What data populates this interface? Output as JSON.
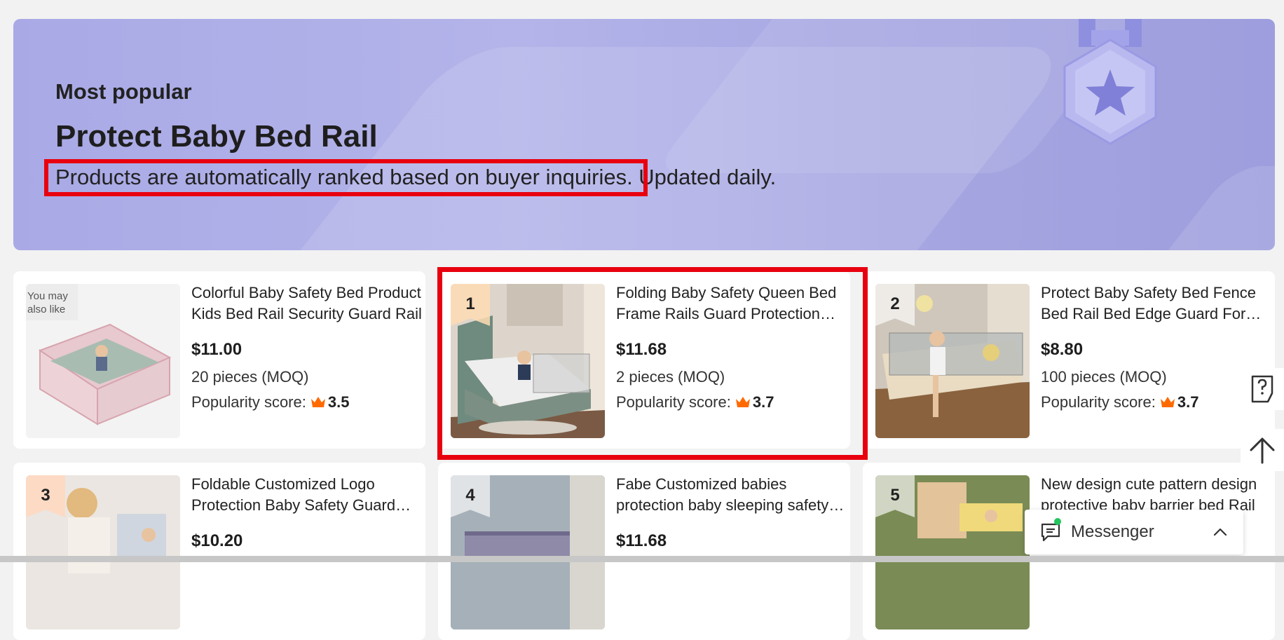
{
  "hero": {
    "subtitle": "Most popular",
    "title": "Protect Baby Bed Rail",
    "description": "Products are automatically ranked based on buyer inquiries. Updated daily."
  },
  "badge_you_may": "You may also like",
  "products": [
    {
      "rank_label": "",
      "title": "Colorful Baby Safety Bed Product Kids Bed Rail Security Guard Rail",
      "price": "$11.00",
      "moq": "20 pieces (MOQ)",
      "popularity_label": "Popularity score:",
      "score": "3.5"
    },
    {
      "rank_label": "1",
      "title": "Folding Baby Safety Queen Bed Frame Rails Guard Protection Fence",
      "price": "$11.68",
      "moq": "2 pieces (MOQ)",
      "popularity_label": "Popularity score:",
      "score": "3.7"
    },
    {
      "rank_label": "2",
      "title": "Protect Baby Safety Bed Fence Bed Rail Bed Edge Guard For Kids",
      "price": "$8.80",
      "moq": "100 pieces (MOQ)",
      "popularity_label": "Popularity score:",
      "score": "3.7"
    },
    {
      "rank_label": "3",
      "title": "Foldable Customized Logo Protection Baby Safety Guard Bed Rail",
      "price": "$10.20",
      "moq": "",
      "popularity_label": "",
      "score": ""
    },
    {
      "rank_label": "4",
      "title": "Fabe Customized babies protection baby sleeping safety bed rail",
      "price": "$11.68",
      "moq": "",
      "popularity_label": "",
      "score": ""
    },
    {
      "rank_label": "5",
      "title": "New design cute pattern design protective baby barrier bed Rail",
      "price": "",
      "moq": "",
      "popularity_label": "",
      "score": ""
    }
  ],
  "messenger": {
    "label": "Messenger"
  },
  "icons": {
    "help": "help-icon",
    "top": "arrow-up-icon",
    "chat": "chat-icon",
    "chevron": "chevron-up-icon",
    "crown": "crown-icon"
  },
  "colors": {
    "highlight": "#e8000f",
    "crown": "#ff6a00",
    "hero_bg": "#aeaee8",
    "online": "#22c55e"
  }
}
